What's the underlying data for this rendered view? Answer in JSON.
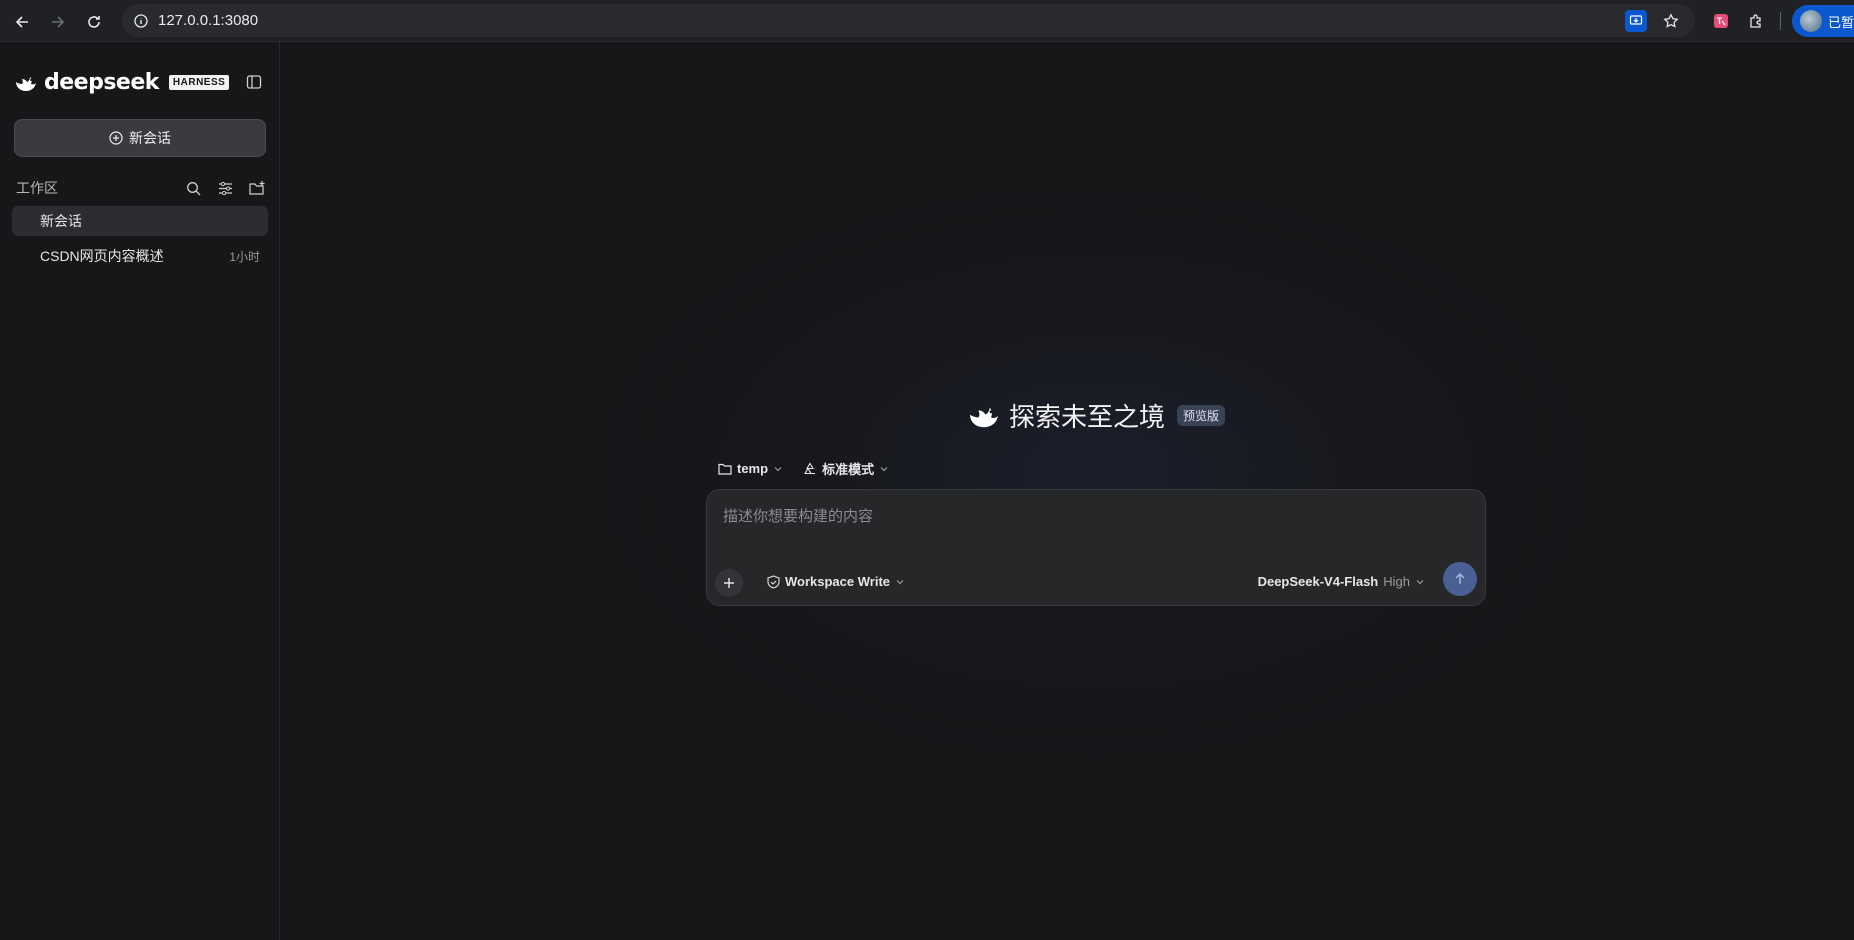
{
  "browser": {
    "url": "127.0.0.1:3080",
    "profile_label": "已暂停"
  },
  "sidebar": {
    "brand_name": "deepseek",
    "brand_badge": "HARNESS",
    "new_chat_label": "新会话",
    "workspace_label": "工作区",
    "folder": "temp",
    "chats": [
      {
        "title": "新会话",
        "time": ""
      },
      {
        "title": "CSDN网页内容概述",
        "time": "1小时"
      }
    ]
  },
  "main": {
    "title": "探索未至之境",
    "badge": "预览版",
    "folder_selector": "temp",
    "mode_selector": "标准模式",
    "input_placeholder": "描述你想要构建的内容",
    "permission": "Workspace Write",
    "model": "DeepSeek-V4-Flash",
    "effort": "High"
  },
  "colors": {
    "accent": "#4a5f93",
    "background": "#151618",
    "sidebar": "#161719",
    "composer": "#262729"
  }
}
